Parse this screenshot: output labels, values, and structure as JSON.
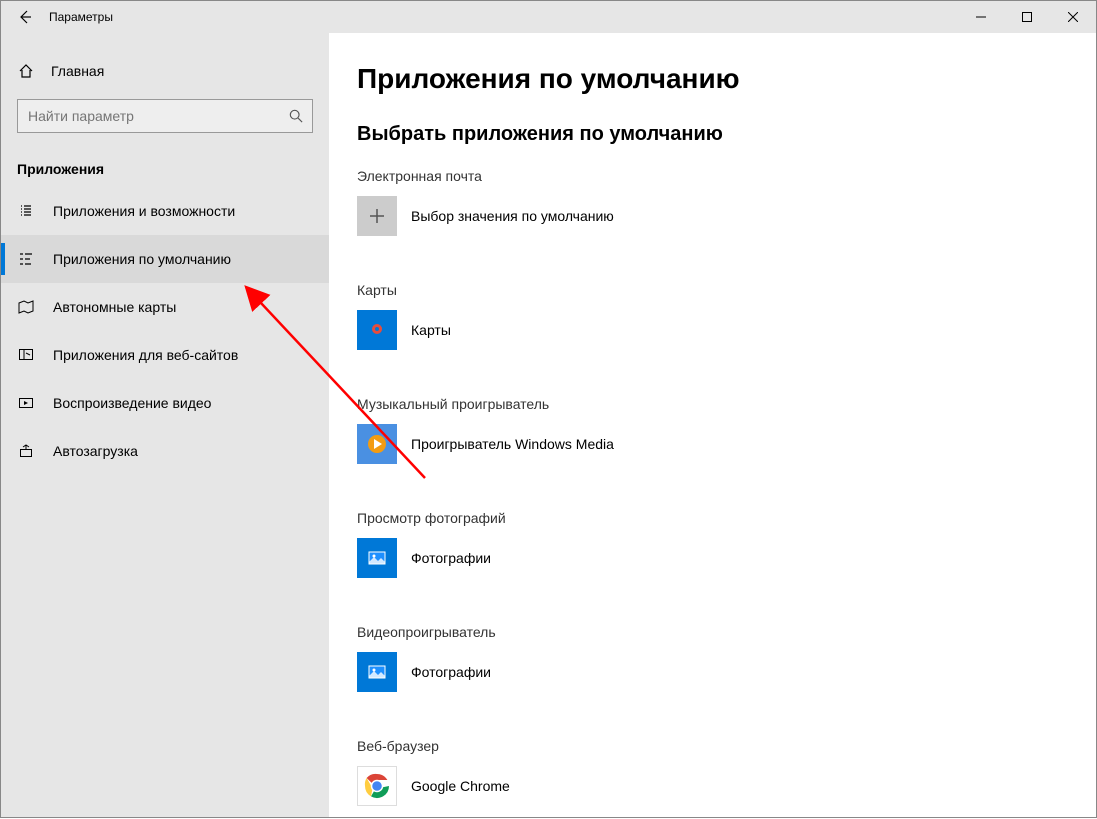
{
  "window": {
    "title": "Параметры"
  },
  "sidebar": {
    "home": "Главная",
    "search_placeholder": "Найти параметр",
    "section": "Приложения",
    "items": [
      {
        "label": "Приложения и возможности"
      },
      {
        "label": "Приложения по умолчанию"
      },
      {
        "label": "Автономные карты"
      },
      {
        "label": "Приложения для веб-сайтов"
      },
      {
        "label": "Воспроизведение видео"
      },
      {
        "label": "Автозагрузка"
      }
    ],
    "active_index": 1
  },
  "main": {
    "heading": "Приложения по умолчанию",
    "subheading": "Выбрать приложения по умолчанию",
    "categories": [
      {
        "label": "Электронная почта",
        "app": "Выбор значения по умолчанию",
        "tile": "plus"
      },
      {
        "label": "Карты",
        "app": "Карты",
        "tile": "maps"
      },
      {
        "label": "Музыкальный проигрыватель",
        "app": "Проигрыватель Windows Media",
        "tile": "wmp"
      },
      {
        "label": "Просмотр фотографий",
        "app": "Фотографии",
        "tile": "photos"
      },
      {
        "label": "Видеопроигрыватель",
        "app": "Фотографии",
        "tile": "photos"
      },
      {
        "label": "Веб-браузер",
        "app": "Google Chrome",
        "tile": "chrome"
      }
    ]
  }
}
